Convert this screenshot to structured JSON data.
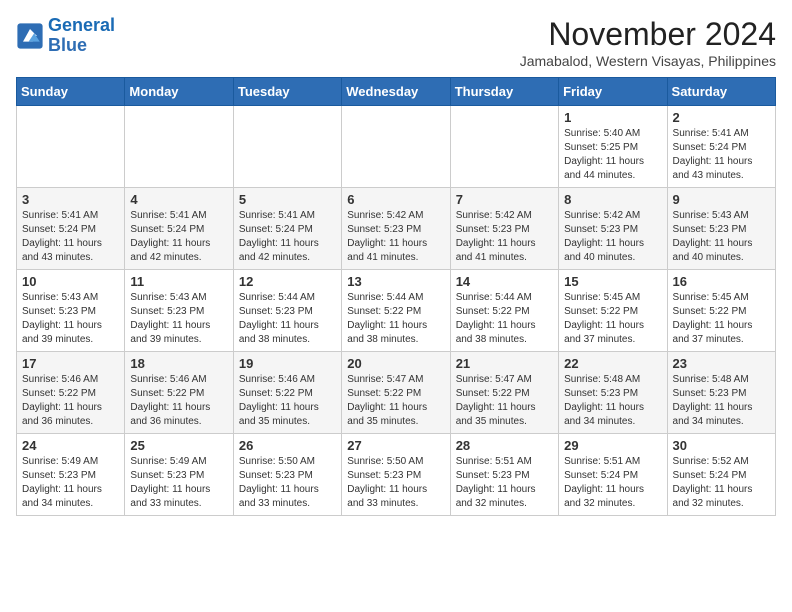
{
  "logo": {
    "line1": "General",
    "line2": "Blue"
  },
  "title": "November 2024",
  "location": "Jamabalod, Western Visayas, Philippines",
  "weekdays": [
    "Sunday",
    "Monday",
    "Tuesday",
    "Wednesday",
    "Thursday",
    "Friday",
    "Saturday"
  ],
  "weeks": [
    [
      {
        "day": "",
        "info": ""
      },
      {
        "day": "",
        "info": ""
      },
      {
        "day": "",
        "info": ""
      },
      {
        "day": "",
        "info": ""
      },
      {
        "day": "",
        "info": ""
      },
      {
        "day": "1",
        "info": "Sunrise: 5:40 AM\nSunset: 5:25 PM\nDaylight: 11 hours and 44 minutes."
      },
      {
        "day": "2",
        "info": "Sunrise: 5:41 AM\nSunset: 5:24 PM\nDaylight: 11 hours and 43 minutes."
      }
    ],
    [
      {
        "day": "3",
        "info": "Sunrise: 5:41 AM\nSunset: 5:24 PM\nDaylight: 11 hours and 43 minutes."
      },
      {
        "day": "4",
        "info": "Sunrise: 5:41 AM\nSunset: 5:24 PM\nDaylight: 11 hours and 42 minutes."
      },
      {
        "day": "5",
        "info": "Sunrise: 5:41 AM\nSunset: 5:24 PM\nDaylight: 11 hours and 42 minutes."
      },
      {
        "day": "6",
        "info": "Sunrise: 5:42 AM\nSunset: 5:23 PM\nDaylight: 11 hours and 41 minutes."
      },
      {
        "day": "7",
        "info": "Sunrise: 5:42 AM\nSunset: 5:23 PM\nDaylight: 11 hours and 41 minutes."
      },
      {
        "day": "8",
        "info": "Sunrise: 5:42 AM\nSunset: 5:23 PM\nDaylight: 11 hours and 40 minutes."
      },
      {
        "day": "9",
        "info": "Sunrise: 5:43 AM\nSunset: 5:23 PM\nDaylight: 11 hours and 40 minutes."
      }
    ],
    [
      {
        "day": "10",
        "info": "Sunrise: 5:43 AM\nSunset: 5:23 PM\nDaylight: 11 hours and 39 minutes."
      },
      {
        "day": "11",
        "info": "Sunrise: 5:43 AM\nSunset: 5:23 PM\nDaylight: 11 hours and 39 minutes."
      },
      {
        "day": "12",
        "info": "Sunrise: 5:44 AM\nSunset: 5:23 PM\nDaylight: 11 hours and 38 minutes."
      },
      {
        "day": "13",
        "info": "Sunrise: 5:44 AM\nSunset: 5:22 PM\nDaylight: 11 hours and 38 minutes."
      },
      {
        "day": "14",
        "info": "Sunrise: 5:44 AM\nSunset: 5:22 PM\nDaylight: 11 hours and 38 minutes."
      },
      {
        "day": "15",
        "info": "Sunrise: 5:45 AM\nSunset: 5:22 PM\nDaylight: 11 hours and 37 minutes."
      },
      {
        "day": "16",
        "info": "Sunrise: 5:45 AM\nSunset: 5:22 PM\nDaylight: 11 hours and 37 minutes."
      }
    ],
    [
      {
        "day": "17",
        "info": "Sunrise: 5:46 AM\nSunset: 5:22 PM\nDaylight: 11 hours and 36 minutes."
      },
      {
        "day": "18",
        "info": "Sunrise: 5:46 AM\nSunset: 5:22 PM\nDaylight: 11 hours and 36 minutes."
      },
      {
        "day": "19",
        "info": "Sunrise: 5:46 AM\nSunset: 5:22 PM\nDaylight: 11 hours and 35 minutes."
      },
      {
        "day": "20",
        "info": "Sunrise: 5:47 AM\nSunset: 5:22 PM\nDaylight: 11 hours and 35 minutes."
      },
      {
        "day": "21",
        "info": "Sunrise: 5:47 AM\nSunset: 5:22 PM\nDaylight: 11 hours and 35 minutes."
      },
      {
        "day": "22",
        "info": "Sunrise: 5:48 AM\nSunset: 5:23 PM\nDaylight: 11 hours and 34 minutes."
      },
      {
        "day": "23",
        "info": "Sunrise: 5:48 AM\nSunset: 5:23 PM\nDaylight: 11 hours and 34 minutes."
      }
    ],
    [
      {
        "day": "24",
        "info": "Sunrise: 5:49 AM\nSunset: 5:23 PM\nDaylight: 11 hours and 34 minutes."
      },
      {
        "day": "25",
        "info": "Sunrise: 5:49 AM\nSunset: 5:23 PM\nDaylight: 11 hours and 33 minutes."
      },
      {
        "day": "26",
        "info": "Sunrise: 5:50 AM\nSunset: 5:23 PM\nDaylight: 11 hours and 33 minutes."
      },
      {
        "day": "27",
        "info": "Sunrise: 5:50 AM\nSunset: 5:23 PM\nDaylight: 11 hours and 33 minutes."
      },
      {
        "day": "28",
        "info": "Sunrise: 5:51 AM\nSunset: 5:23 PM\nDaylight: 11 hours and 32 minutes."
      },
      {
        "day": "29",
        "info": "Sunrise: 5:51 AM\nSunset: 5:24 PM\nDaylight: 11 hours and 32 minutes."
      },
      {
        "day": "30",
        "info": "Sunrise: 5:52 AM\nSunset: 5:24 PM\nDaylight: 11 hours and 32 minutes."
      }
    ]
  ]
}
